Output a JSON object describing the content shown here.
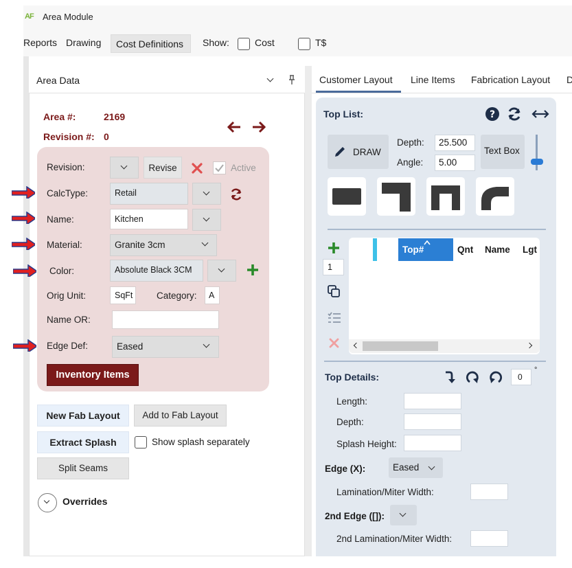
{
  "window": {
    "title": "Area Module",
    "icon_text": "AF"
  },
  "menubar": {
    "items": [
      "Reports",
      "Drawing",
      "Cost Definitions"
    ],
    "show_label": "Show:",
    "cost_label": "Cost",
    "ts_label": "T$"
  },
  "left_panel": {
    "title": "Area Data",
    "area_label": "Area #:",
    "area_value": "2169",
    "revision_label": "Revision #:",
    "revision_value": "0",
    "card": {
      "revision_label": "Revision:",
      "revise_button": "Revise",
      "active_label": "Active",
      "calctype_label": "CalcType:",
      "calctype_value": "Retail",
      "name_label": "Name:",
      "name_value": "Kitchen",
      "material_label": "Material:",
      "material_value": "Granite 3cm",
      "color_label": "Color:",
      "color_value": "Absolute Black 3CM",
      "orig_unit_label": "Orig Unit:",
      "orig_unit_value": "SqFt",
      "category_label": "Category:",
      "category_value": "A",
      "name_or_label": "Name OR:",
      "name_or_value": "",
      "edge_def_label": "Edge Def:",
      "edge_def_value": "Eased",
      "inventory_button": "Inventory Items"
    },
    "new_fab_button": "New Fab Layout",
    "add_fab_button": "Add to Fab Layout",
    "extract_splash_button": "Extract Splash",
    "show_splash_label": "Show splash separately",
    "split_seams_button": "Split Seams",
    "overrides_label": "Overrides"
  },
  "tabs": [
    "Customer Layout",
    "Line Items",
    "Fabrication Layout",
    "D"
  ],
  "right_panel": {
    "top_list_title": "Top List:",
    "draw_button": "DRAW",
    "depth_label": "Depth:",
    "depth_value": "25.500",
    "angle_label": "Angle:",
    "angle_value": "5.00",
    "text_box_button": "Text Box",
    "qty_value": "1",
    "columns": [
      "Top#",
      "Qnt",
      "Name",
      "Lgt"
    ],
    "top_details_title": "Top Details:",
    "rotation_value": "0",
    "degree_symbol": "°",
    "length_label": "Length:",
    "depth2_label": "Depth:",
    "splash_height_label": "Splash Height:",
    "edge_x_label": "Edge (X):",
    "edge_x_value": "Eased",
    "lamination_label": "Lamination/Miter Width:",
    "edge2_label": "2nd Edge ([]):",
    "lamination2_label": "2nd Lamination/Miter Width:"
  },
  "colors": {
    "accent_red": "#7b1a1a",
    "card_pink": "#eddada",
    "panel_blue": "#e3e9f0",
    "arrow_red": "#e02020",
    "plus_green": "#2a8a2a"
  }
}
